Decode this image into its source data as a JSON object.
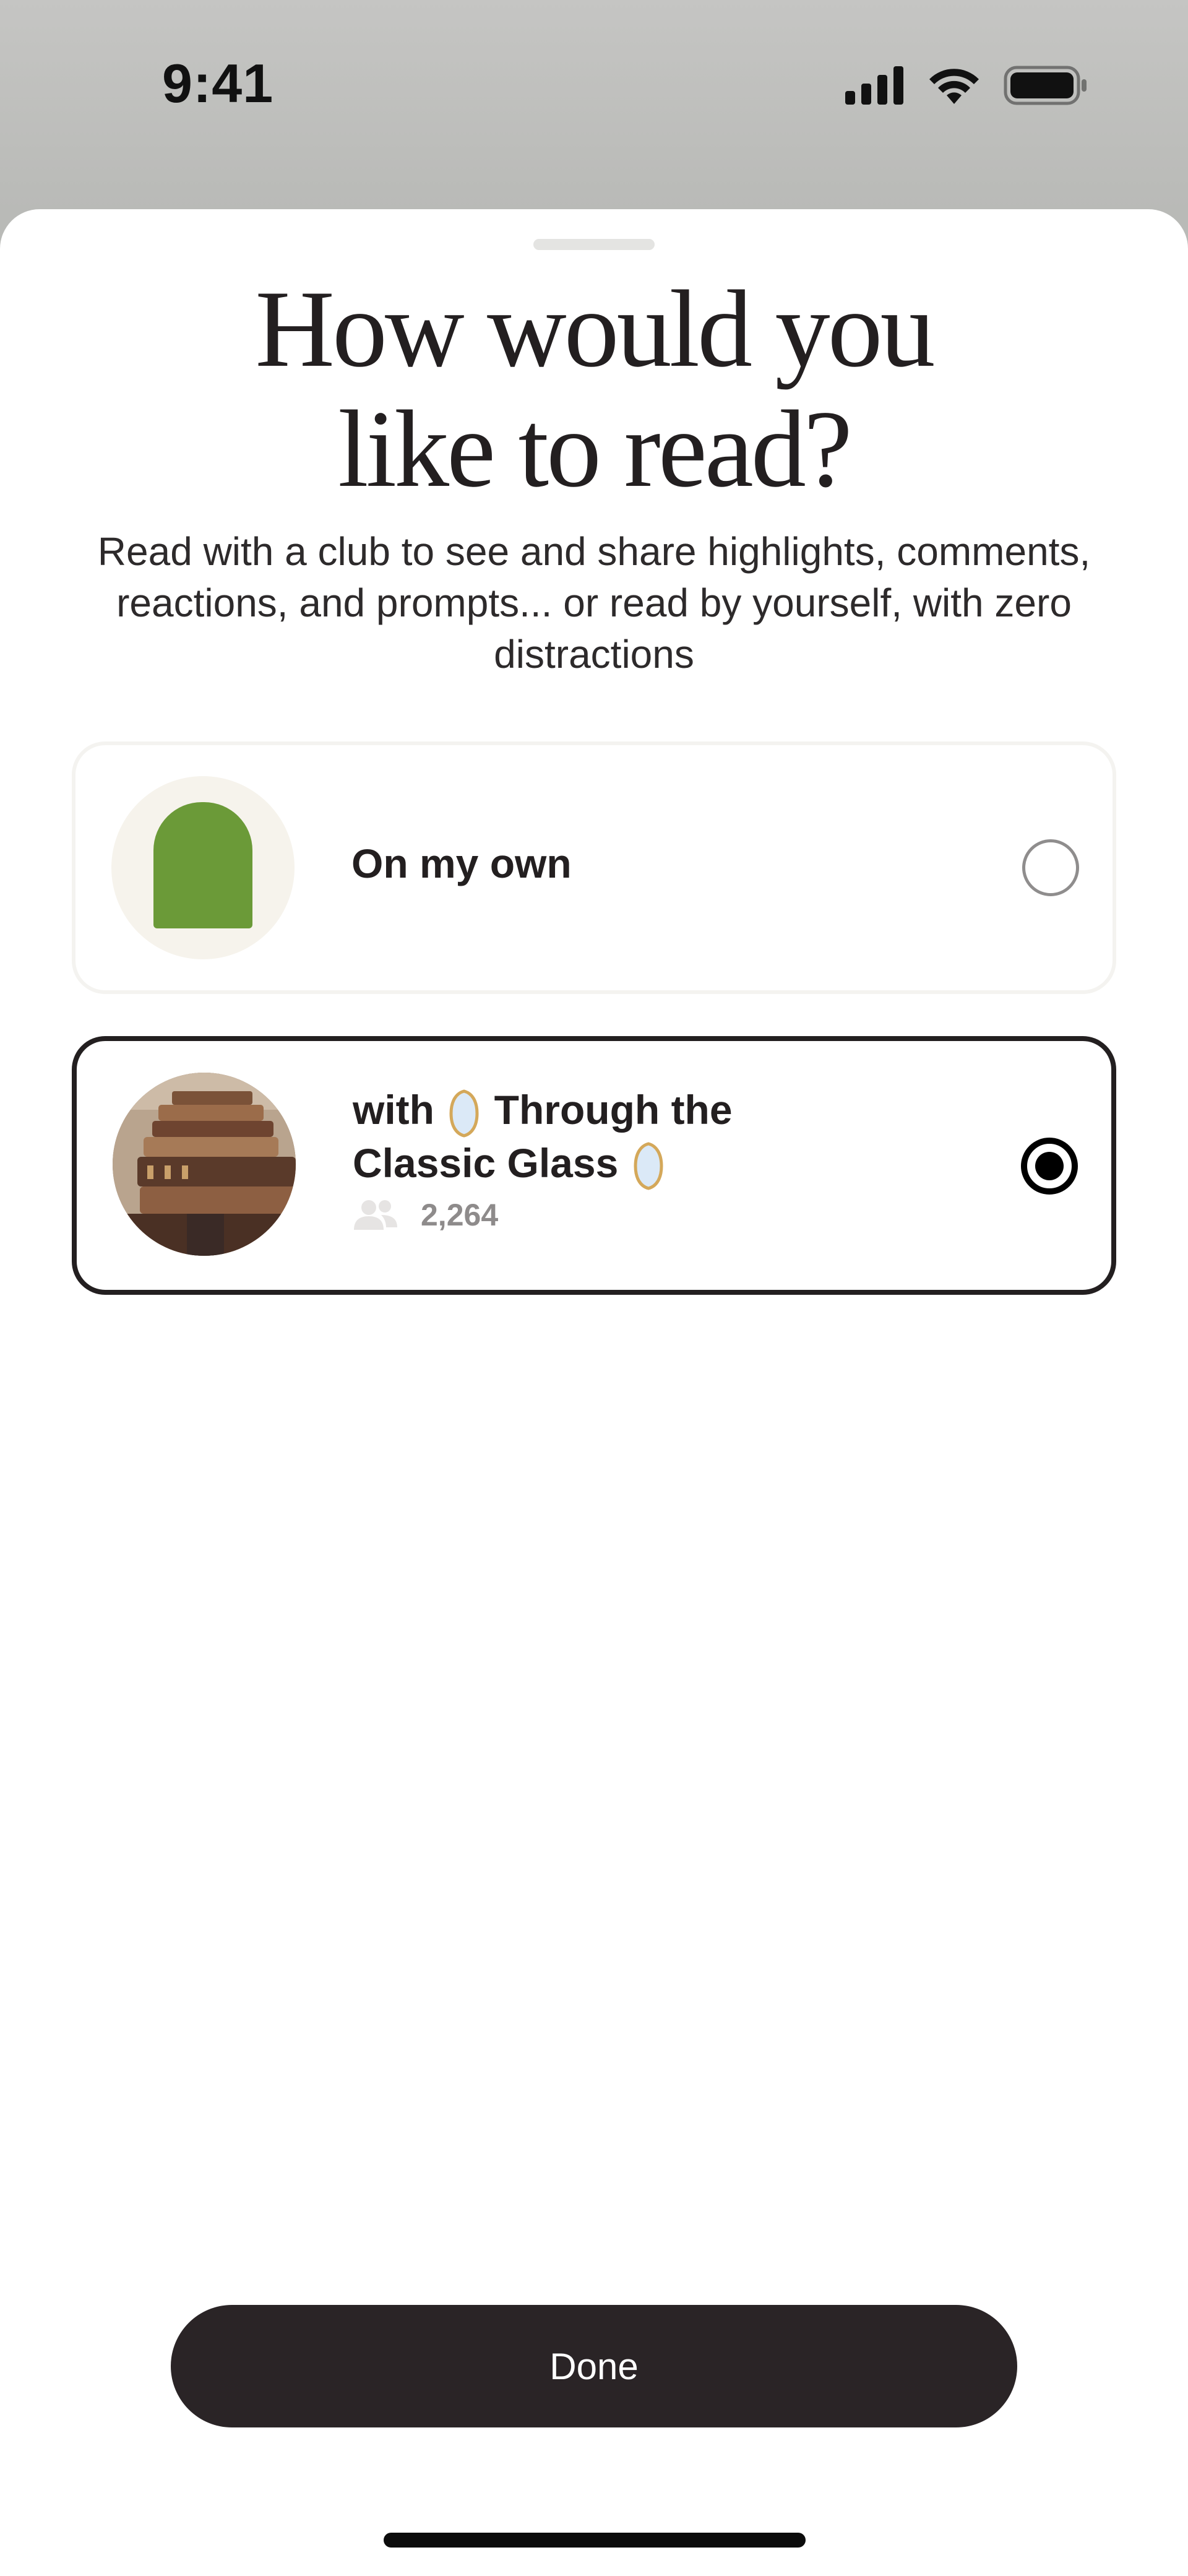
{
  "status_bar": {
    "time": "9:41",
    "icons": [
      "cellular-signal-icon",
      "wifi-icon",
      "battery-icon"
    ]
  },
  "sheet": {
    "title_line1": "How would you",
    "title_line2": "like to read?",
    "subtitle": "Read with a club to see and share highlights, comments, reactions, and prompts... or read by yourself, with zero distractions"
  },
  "options": [
    {
      "label": "On my own",
      "selected": false,
      "avatar_icon": "beanie-hat-icon"
    },
    {
      "label_prefix": "with",
      "club_name_line1": "Through the",
      "club_name_line2": "Classic Glass",
      "member_count": "2,264",
      "selected": true,
      "avatar_icon": "stacked-books-image"
    }
  ],
  "done_button": {
    "label": "Done"
  },
  "colors": {
    "accent_dark": "#231f20",
    "button_bg": "#2a2426",
    "beanie_green": "#6b9a38",
    "gem_fill": "#dbe9f7",
    "gem_frame": "#d4a85a"
  }
}
